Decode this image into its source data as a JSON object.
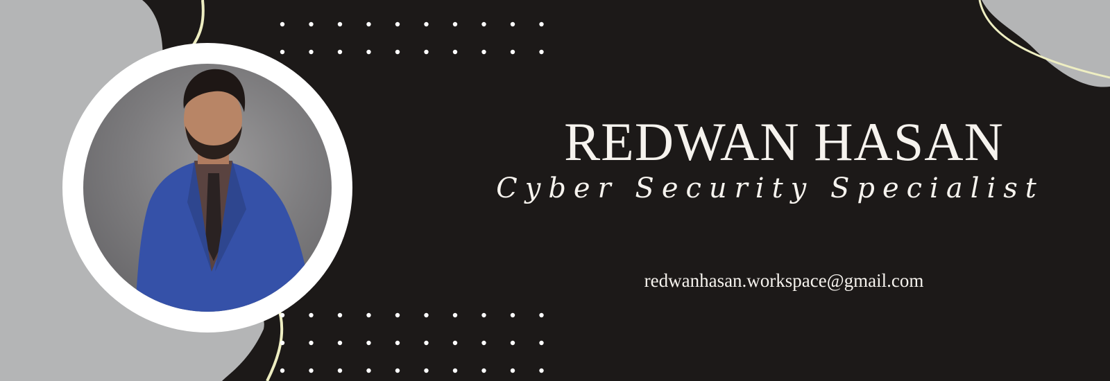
{
  "banner": {
    "name": "REDWAN HASAN",
    "title": "Cyber Security Specialist",
    "email": "redwanhasan.workspace@gmail.com"
  },
  "colors": {
    "background": "#1c1918",
    "accent_shape": "#b4b5b6",
    "line_accent": "#eeeec2",
    "text": "#f6f3ee",
    "dots": "#ffffff",
    "photo_ring": "#ffffff"
  },
  "photo": {
    "description_icon": "portrait-photo"
  }
}
